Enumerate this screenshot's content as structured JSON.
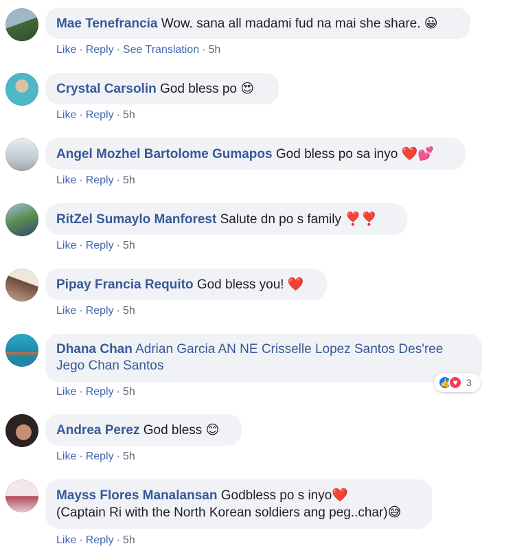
{
  "comments": [
    {
      "author": "Mae Tenefrancia",
      "text": "Wow. sana all madami fud na mai she share.",
      "emoji": "😀",
      "actions": {
        "like": "Like",
        "reply": "Reply",
        "translate": "See Translation",
        "time": "5h"
      },
      "avatar_colors": [
        "#3f6b3a",
        "#9fb7c9"
      ]
    },
    {
      "author": "Crystal Carsolin",
      "text": "God bless po",
      "emoji": "😍",
      "actions": {
        "like": "Like",
        "reply": "Reply",
        "time": "5h"
      },
      "avatar_colors": [
        "#4fb8c8",
        "#d7c3a1"
      ]
    },
    {
      "author": "Angel Mozhel Bartolome Gumapos",
      "text": "God bless po sa inyo",
      "emoji": "❤️💕",
      "actions": {
        "like": "Like",
        "reply": "Reply",
        "time": "5h"
      },
      "avatar_colors": [
        "#e8ecef",
        "#9aa6ad"
      ]
    },
    {
      "author": "RitZel Sumaylo Manforest",
      "text": "Salute dn po s family",
      "emoji": "❣️❣️",
      "actions": {
        "like": "Like",
        "reply": "Reply",
        "time": "5h"
      },
      "avatar_colors": [
        "#5b8a4e",
        "#2e4a7a"
      ]
    },
    {
      "author": "Pipay Francia Requito",
      "text": "God bless you!",
      "emoji": "❤️",
      "actions": {
        "like": "Like",
        "reply": "Reply",
        "time": "5h"
      },
      "avatar_colors": [
        "#efe6dc",
        "#6b4a3a"
      ]
    },
    {
      "author": "Dhana Chan",
      "text": "Adrian Garcia AN NE Crisselle Lopez Santos Des'ree Jego Chan Santos",
      "emoji": "",
      "actions": {
        "like": "Like",
        "reply": "Reply",
        "time": "5h"
      },
      "reactions": {
        "count": "3",
        "types": [
          "like-icon",
          "love-icon"
        ]
      },
      "avatar_colors": [
        "#1f88a8",
        "#c96b3c"
      ]
    },
    {
      "author": "Andrea Perez",
      "text": "God bless",
      "emoji": "😊",
      "actions": {
        "like": "Like",
        "reply": "Reply",
        "time": "5h"
      },
      "avatar_colors": [
        "#2b2320",
        "#c58f73"
      ]
    },
    {
      "author": "Mayss Flores Manalansan",
      "text": "Godbless po s inyo",
      "emoji": "❤️",
      "text2": "(Captain Ri with the North Korean soldiers ang peg..char)",
      "emoji2": "😅",
      "actions": {
        "like": "Like",
        "reply": "Reply",
        "time": "5h"
      },
      "avatar_colors": [
        "#f3e7ea",
        "#b24a5a"
      ]
    }
  ],
  "colors": {
    "author": "#385898",
    "bubble": "#f0f2f5",
    "meta": "#606770",
    "like_blue": "#1877f2",
    "love_red": "#f33e58"
  }
}
